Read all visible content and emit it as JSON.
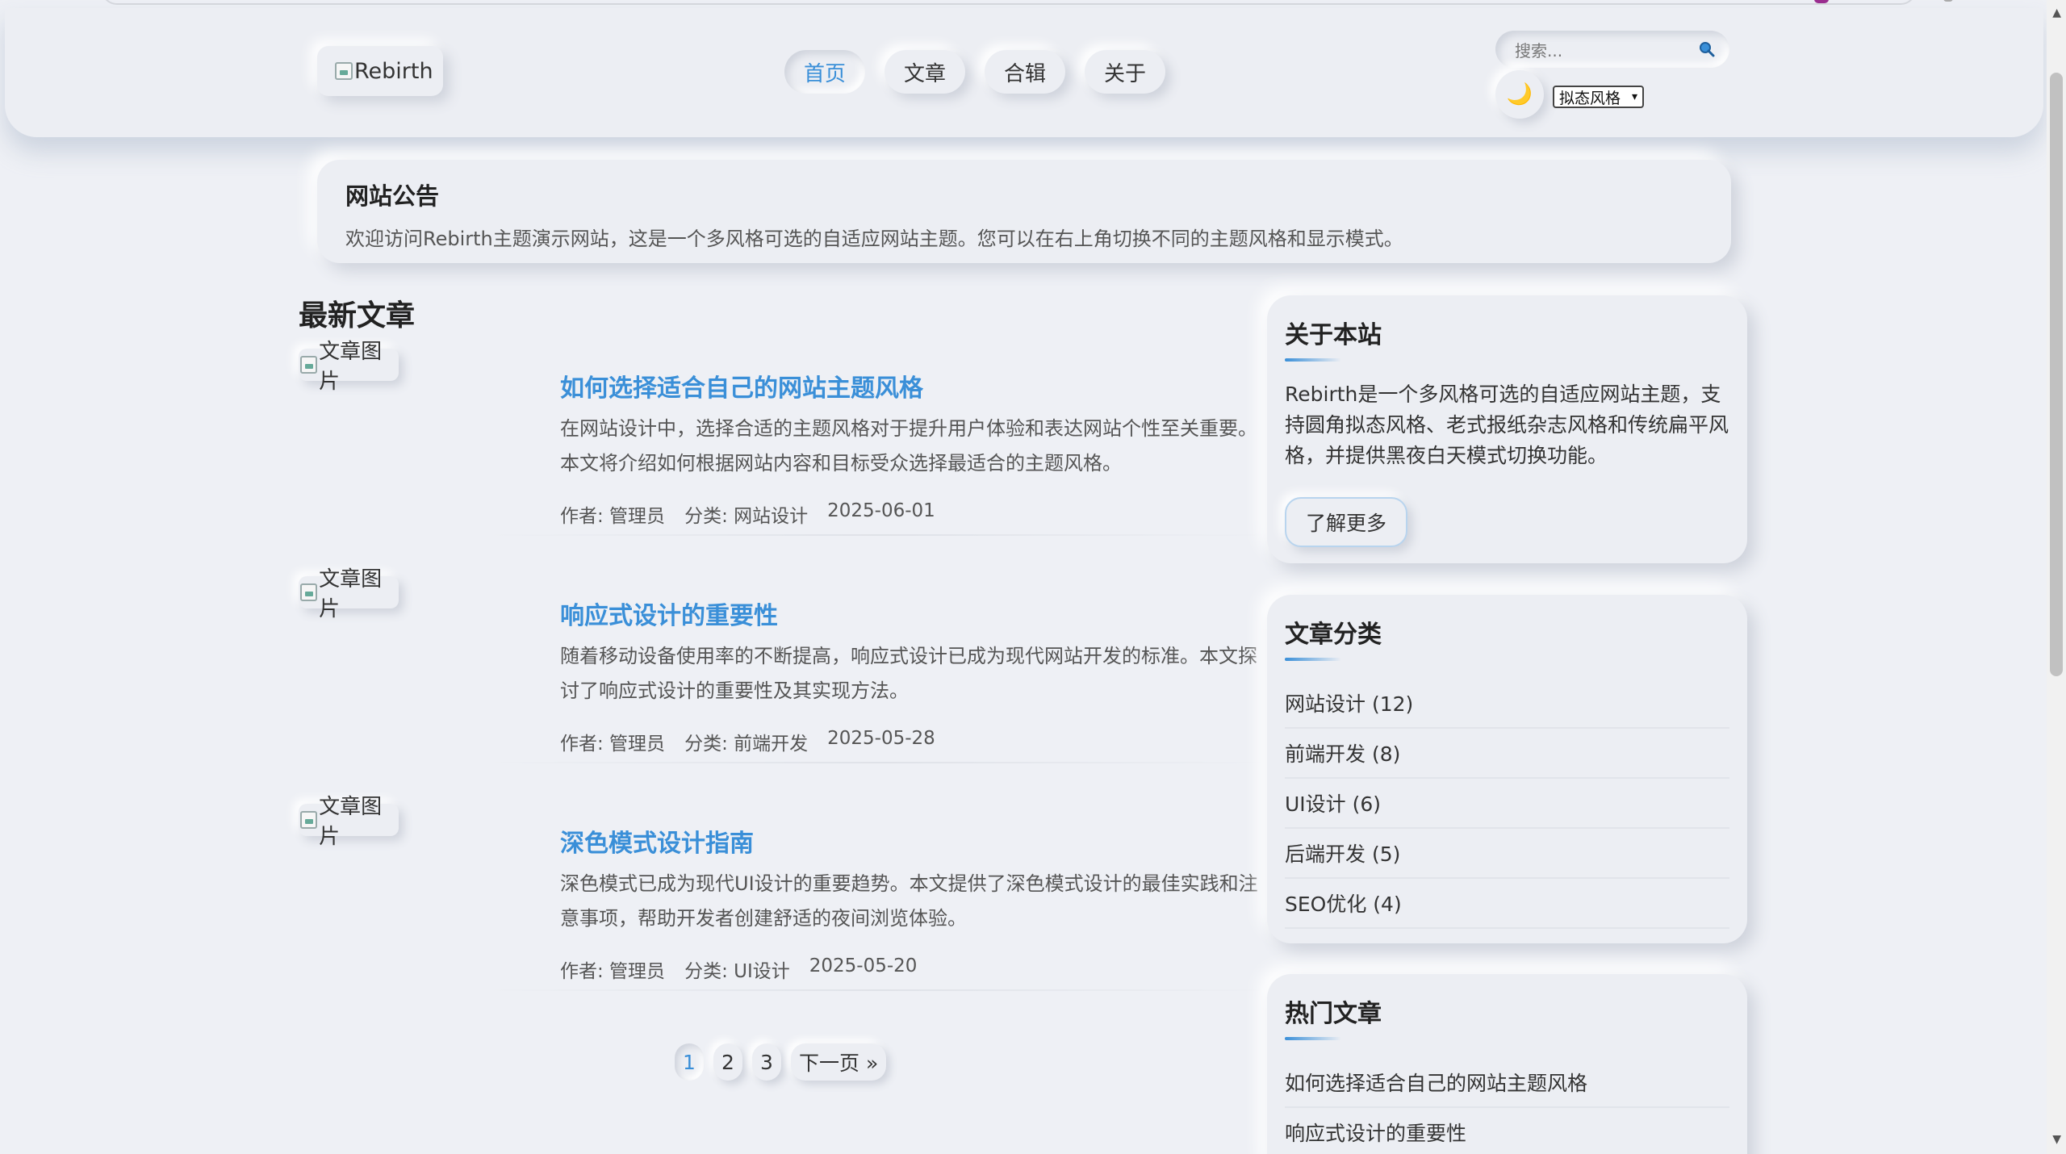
{
  "header": {
    "logo_alt": "Rebirth",
    "nav": [
      "首页",
      "文章",
      "合辑",
      "关于"
    ],
    "search_placeholder": "搜索...",
    "mode_icon": "🌙",
    "style_select": "拟态风格"
  },
  "notice": {
    "title": "网站公告",
    "text": "欢迎访问Rebirth主题演示网站，这是一个多风格可选的自适应网站主题。您可以在右上角切换不同的主题风格和显示模式。"
  },
  "latest": {
    "title": "最新文章",
    "articles": [
      {
        "thumb_alt": "文章图片",
        "title": "如何选择适合自己的网站主题风格",
        "excerpt": "在网站设计中，选择合适的主题风格对于提升用户体验和表达网站个性至关重要。本文将介绍如何根据网站内容和目标受众选择最适合的主题风格。",
        "author": "作者: 管理员",
        "category": "分类: 网站设计",
        "date": "2025-06-01"
      },
      {
        "thumb_alt": "文章图片",
        "title": "响应式设计的重要性",
        "excerpt": "随着移动设备使用率的不断提高，响应式设计已成为现代网站开发的标准。本文探讨了响应式设计的重要性及其实现方法。",
        "author": "作者: 管理员",
        "category": "分类: 前端开发",
        "date": "2025-05-28"
      },
      {
        "thumb_alt": "文章图片",
        "title": "深色模式设计指南",
        "excerpt": "深色模式已成为现代UI设计的重要趋势。本文提供了深色模式设计的最佳实践和注意事项，帮助开发者创建舒适的夜间浏览体验。",
        "author": "作者: 管理员",
        "category": "分类: UI设计",
        "date": "2025-05-20"
      }
    ],
    "pagination": [
      "1",
      "2",
      "3",
      "下一页 »"
    ]
  },
  "sidebar": {
    "about": {
      "title": "关于本站",
      "text": "Rebirth是一个多风格可选的自适应网站主题，支持圆角拟态风格、老式报纸杂志风格和传统扁平风格，并提供黑夜白天模式切换功能。",
      "button": "了解更多"
    },
    "categories": {
      "title": "文章分类",
      "items": [
        "网站设计 (12)",
        "前端开发 (8)",
        "UI设计 (6)",
        "后端开发 (5)",
        "SEO优化 (4)"
      ]
    },
    "hot": {
      "title": "热门文章",
      "items": [
        "如何选择适合自己的网站主题风格",
        "响应式设计的重要性"
      ]
    }
  }
}
